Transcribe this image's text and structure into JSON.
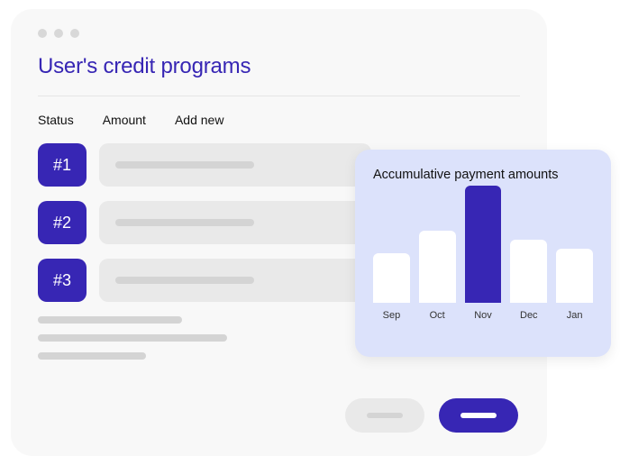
{
  "title": "User's credit programs",
  "columns": {
    "status": "Status",
    "amount": "Amount",
    "addnew": "Add new"
  },
  "rows": [
    {
      "badge": "#1"
    },
    {
      "badge": "#2"
    },
    {
      "badge": "#3"
    }
  ],
  "chart": {
    "title": "Accumulative payment amounts"
  },
  "chart_data": {
    "type": "bar",
    "title": "Accumulative payment amounts",
    "categories": [
      "Sep",
      "Oct",
      "Nov",
      "Dec",
      "Jan"
    ],
    "values": [
      55,
      80,
      130,
      70,
      60
    ],
    "highlight_index": 2,
    "ylim": [
      0,
      140
    ],
    "xlabel": "",
    "ylabel": ""
  },
  "colors": {
    "accent": "#3726b4",
    "chart_bg": "#dce2fb",
    "surface": "#f8f8f8",
    "muted": "#e9e9e9"
  }
}
